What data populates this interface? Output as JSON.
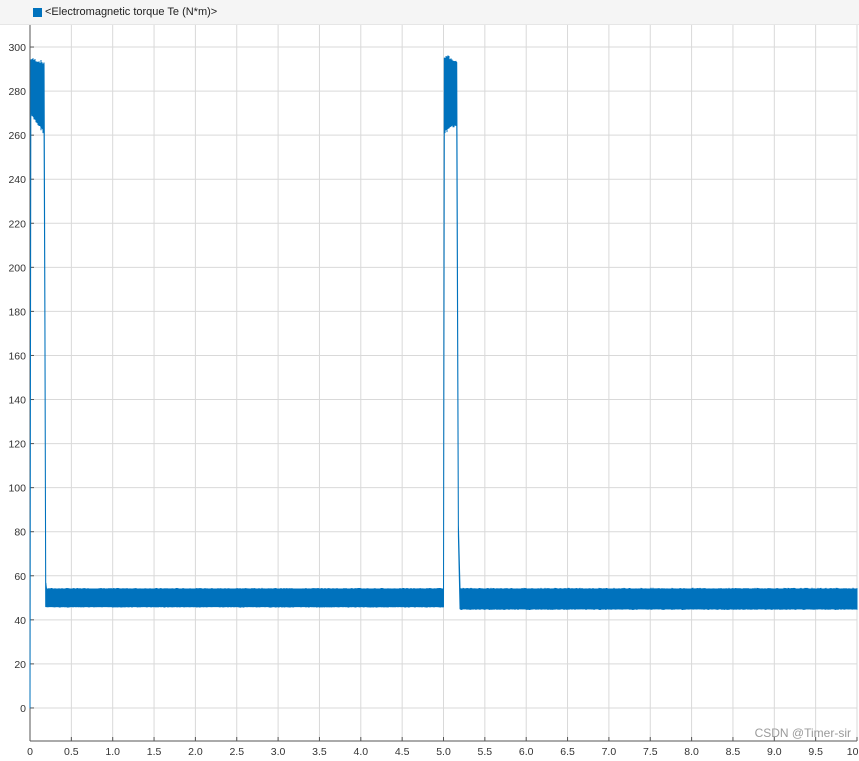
{
  "legend": {
    "label": "<Electromagnetic torque Te (N*m)>"
  },
  "watermark": "CSDN @Timer-sir",
  "colors": {
    "series": "#0072bd",
    "grid": "#d9d9d9",
    "background": "#ffffff",
    "legend_background": "#f5f5f5"
  },
  "chart_data": {
    "type": "line",
    "title": "",
    "xlabel": "",
    "ylabel": "",
    "xlim": [
      0,
      10
    ],
    "ylim": [
      -15,
      310
    ],
    "grid": true,
    "legend_position": "top-left",
    "x_ticks": [
      0,
      0.5,
      1.0,
      1.5,
      2.0,
      2.5,
      3.0,
      3.5,
      4.0,
      4.5,
      5.0,
      5.5,
      6.0,
      6.5,
      7.0,
      7.5,
      8.0,
      8.5,
      9.0,
      9.5,
      10.0
    ],
    "x_tick_labels": [
      "0",
      "0.5",
      "1.0",
      "1.5",
      "2.0",
      "2.5",
      "3.0",
      "3.5",
      "4.0",
      "4.5",
      "5.0",
      "5.5",
      "6.0",
      "6.5",
      "7.0",
      "7.5",
      "8.0",
      "8.5",
      "9.0",
      "9.5",
      "10.0"
    ],
    "y_ticks": [
      0,
      20,
      40,
      60,
      80,
      100,
      120,
      140,
      160,
      180,
      200,
      220,
      240,
      260,
      280,
      300
    ],
    "y_tick_labels": [
      "0",
      "20",
      "40",
      "60",
      "80",
      "100",
      "120",
      "140",
      "160",
      "180",
      "200",
      "220",
      "240",
      "260",
      "280",
      "300"
    ],
    "series": [
      {
        "name": "<Electromagnetic torque Te (N*m)>",
        "style": "noisy band (min/max envelope)",
        "x": [
          0,
          0.01,
          0.17,
          0.18,
          0.19,
          0.2,
          5.0,
          5.01,
          5.16,
          5.18,
          5.2,
          10.0
        ],
        "y_min": [
          0,
          270,
          262,
          174,
          46,
          46,
          46,
          262,
          266,
          78,
          45,
          45
        ],
        "y_max": [
          0,
          294,
          292,
          185,
          57,
          54,
          54,
          295,
          293,
          83,
          54,
          54
        ]
      }
    ]
  }
}
